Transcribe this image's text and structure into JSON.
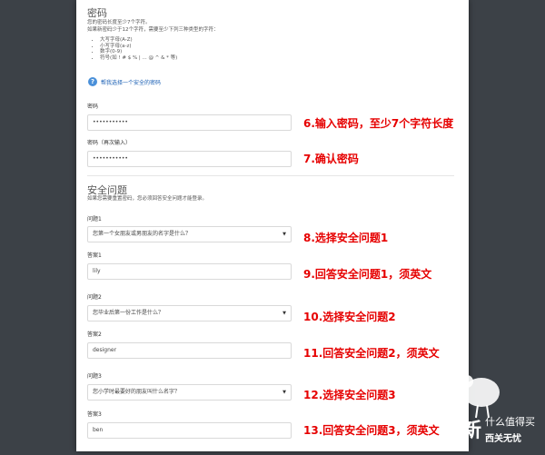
{
  "password_section": {
    "title": "密码",
    "rule_line1": "您的密码长度至少7个字符。",
    "rule_line2": "如果新密码少于12个字符，需要至少下列三种类型的字符：",
    "requirements": [
      "大写字母(A-Z)",
      "小写字母(a-z)",
      "数字(0-9)",
      "符号(如 ! # $ % | ... @ ^ & * 等)"
    ],
    "help_link": "帮我选择一个安全的密码",
    "password_label": "密码",
    "password_value": "•••••••••••",
    "confirm_label": "密码（再次输入）",
    "confirm_value": "•••••••••••"
  },
  "security_section": {
    "title": "安全问题",
    "description": "如果您需要重置密码，您必须回答安全问题才能登录。",
    "questions": [
      {
        "q_label": "问题1",
        "q_value": "您第一个女朋友或男朋友的名字是什么？",
        "a_label": "答案1",
        "a_value": "lily"
      },
      {
        "q_label": "问题2",
        "q_value": "您毕业后第一份工作是什么？",
        "a_label": "答案2",
        "a_value": "designer"
      },
      {
        "q_label": "问题3",
        "q_value": "您小学时最要好的朋友叫什么名字？",
        "a_label": "答案3",
        "a_value": "ben"
      }
    ]
  },
  "annotations": [
    "6.输入密码，至少7个字符长度",
    "7.确认密码",
    "8.选择安全问题1",
    "9.回答安全问题1，须英文",
    "10.选择安全问题2",
    "11.回答安全问题2，须英文",
    "12.选择安全问题3",
    "13.回答安全问题3，须英文"
  ],
  "watermark": {
    "big": "新",
    "line1": "什么值得买",
    "line2": "西关无忧"
  },
  "colors": {
    "annotation": "#e60000",
    "link": "#1a5fb4",
    "backdrop": "#3c4147"
  }
}
